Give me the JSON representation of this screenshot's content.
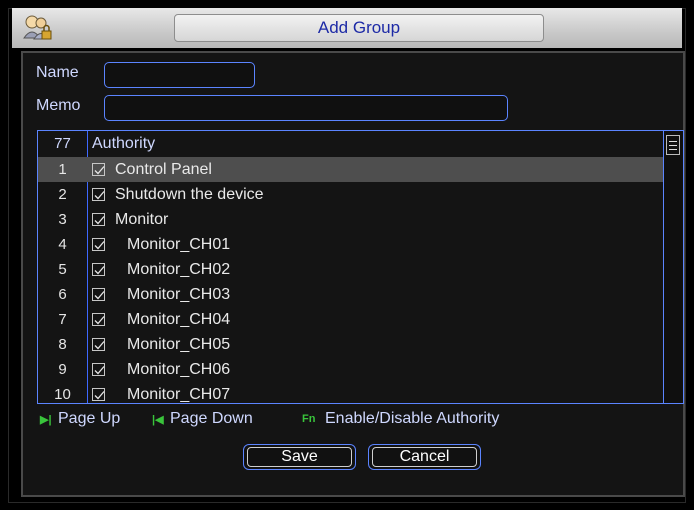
{
  "window": {
    "title": "Add Group",
    "icon": "users-lock-icon"
  },
  "form": {
    "name_label": "Name",
    "name_value": "",
    "memo_label": "Memo",
    "memo_value": ""
  },
  "table": {
    "header_count": "77",
    "header_title": "Authority",
    "rows": [
      {
        "num": "1",
        "label": "Control Panel",
        "checked": true,
        "indent": false,
        "selected": true
      },
      {
        "num": "2",
        "label": "Shutdown the device",
        "checked": true,
        "indent": false,
        "selected": false
      },
      {
        "num": "3",
        "label": "Monitor",
        "checked": true,
        "indent": false,
        "selected": false
      },
      {
        "num": "4",
        "label": "Monitor_CH01",
        "checked": true,
        "indent": true,
        "selected": false
      },
      {
        "num": "5",
        "label": "Monitor_CH02",
        "checked": true,
        "indent": true,
        "selected": false
      },
      {
        "num": "6",
        "label": "Monitor_CH03",
        "checked": true,
        "indent": true,
        "selected": false
      },
      {
        "num": "7",
        "label": "Monitor_CH04",
        "checked": true,
        "indent": true,
        "selected": false
      },
      {
        "num": "8",
        "label": "Monitor_CH05",
        "checked": true,
        "indent": true,
        "selected": false
      },
      {
        "num": "9",
        "label": "Monitor_CH06",
        "checked": true,
        "indent": true,
        "selected": false
      },
      {
        "num": "10",
        "label": "Monitor_CH07",
        "checked": true,
        "indent": true,
        "selected": false
      }
    ]
  },
  "hints": {
    "page_up_icon": "▶|",
    "page_up": "Page Up",
    "page_down_icon": "|◀",
    "page_down": "Page Down",
    "fn_icon": "Fn",
    "fn": "Enable/Disable Authority"
  },
  "buttons": {
    "save": "Save",
    "cancel": "Cancel"
  },
  "colors": {
    "accent": "#5b84ff",
    "title_text": "#1d2aa6",
    "hint_icon": "#39c43b",
    "selected_row": "#4e4e4e"
  }
}
